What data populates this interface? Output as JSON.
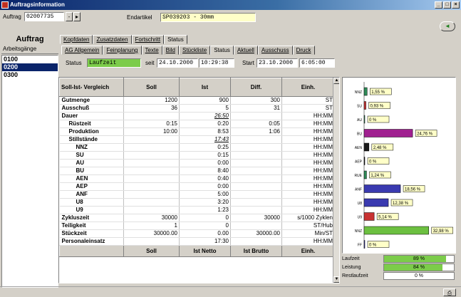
{
  "window": {
    "title": "Auftragsinformation"
  },
  "header": {
    "auftrag_label": "Auftrag",
    "auftrag_value": "02007735",
    "endartikel_label": "Endartikel",
    "endartikel_value": "SP039203 - 30mm",
    "section_title": "Auftrag"
  },
  "main_tabs": [
    "Kopfdaten",
    "Zusatzdaten",
    "Fortschritt",
    "Status"
  ],
  "sub_tabs": [
    "AG Allgemein",
    "Feinplanung",
    "Texte",
    "Bild",
    "Stückliste",
    "Status",
    "Aktuell",
    "Ausschuss",
    "Druck"
  ],
  "active_main_tab": 3,
  "active_sub_tab": 5,
  "status": {
    "label": "Status",
    "value": "Laufzeit",
    "seit_label": "seit",
    "seit_date": "24.10.2000",
    "seit_time": "10:29:38",
    "start_label": "Start",
    "start_date": "23.10.2000",
    "start_time": "6:05:00"
  },
  "left_panel": {
    "header": "Arbeitsgänge",
    "items": [
      "0100",
      "0200",
      "0300"
    ],
    "selected": 1
  },
  "grid": {
    "headers": [
      "Soll-Ist- Vergleich",
      "Soll",
      "Ist",
      "Diff.",
      "Einh."
    ],
    "footer": [
      "",
      "Soll",
      "Ist Netto",
      "Ist Brutto",
      "Einh."
    ],
    "rows": [
      {
        "name": "Gutmenge",
        "soll": "1200",
        "ist": "900",
        "diff": "300",
        "unit": "ST"
      },
      {
        "name": "Ausschuß",
        "soll": "36",
        "ist": "5",
        "diff": "31",
        "unit": "ST"
      },
      {
        "name": "Dauer",
        "soll": "",
        "ist": "26:50",
        "diff": "",
        "unit": "HH:MM"
      },
      {
        "name": "Rüstzeit",
        "soll": "0:15",
        "ist": "0:20",
        "diff": "0:05",
        "unit": "HH:MM"
      },
      {
        "name": "Produktion",
        "soll": "10:00",
        "ist": "8:53",
        "diff": "1:06",
        "unit": "HH:MM"
      },
      {
        "name": "Stillstände",
        "soll": "",
        "ist": "17:43",
        "diff": "",
        "unit": "HH:MM"
      },
      {
        "name": "NNZ",
        "soll": "",
        "ist": "0:25",
        "diff": "",
        "unit": "HH:MM"
      },
      {
        "name": "SU",
        "soll": "",
        "ist": "0:15",
        "diff": "",
        "unit": "HH:MM"
      },
      {
        "name": "AU",
        "soll": "",
        "ist": "0:00",
        "diff": "",
        "unit": "HH:MM"
      },
      {
        "name": "BU",
        "soll": "",
        "ist": "8:40",
        "diff": "",
        "unit": "HH:MM"
      },
      {
        "name": "AEN",
        "soll": "",
        "ist": "0:40",
        "diff": "",
        "unit": "HH:MM"
      },
      {
        "name": "AEP",
        "soll": "",
        "ist": "0:00",
        "diff": "",
        "unit": "HH:MM"
      },
      {
        "name": "ANF",
        "soll": "",
        "ist": "5:00",
        "diff": "",
        "unit": "HH:MM"
      },
      {
        "name": "U8",
        "soll": "",
        "ist": "3:20",
        "diff": "",
        "unit": "HH:MM"
      },
      {
        "name": "U9",
        "soll": "",
        "ist": "1:23",
        "diff": "",
        "unit": "HH:MM"
      },
      {
        "name": "Zykluszeit",
        "soll": "30000",
        "ist": "0",
        "diff": "30000",
        "unit": "s/1000 Zyklen"
      },
      {
        "name": "Teiligkeit",
        "soll": "1",
        "ist": "0",
        "diff": "",
        "unit": "ST/Hub"
      },
      {
        "name": "Stückzeit",
        "soll": "30000.00",
        "ist": "0.00",
        "diff": "30000.00",
        "unit": "Min/ST"
      },
      {
        "name": "Personaleinsatz",
        "soll": "",
        "ist": "17:30",
        "diff": "",
        "unit": "HH:MM"
      }
    ]
  },
  "chart_data": {
    "type": "bar",
    "orientation": "horizontal",
    "categories": [
      "NNZ",
      "SU",
      "AU",
      "BU",
      "AEN",
      "AEP",
      "RUE",
      "ANF",
      "U8",
      "U9",
      "NNZ",
      "FF"
    ],
    "values": [
      1.55,
      0.93,
      0,
      24.76,
      2.48,
      0,
      1.24,
      18.56,
      12.38,
      5.14,
      32.98,
      0
    ],
    "value_labels": [
      "1,55 %",
      "0,93 %",
      "0 %",
      "24,76 %",
      "2,48 %",
      "0 %",
      "1,24 %",
      "18,56 %",
      "12,38 %",
      "5,14 %",
      "32,98 %",
      "0 %"
    ],
    "colors": [
      "#2e8b57",
      "#c83232",
      "#2e8b57",
      "#a02090",
      "#1a1a1a",
      "#1a1a1a",
      "#2e8b57",
      "#3a3ab0",
      "#3a3ab0",
      "#c83232",
      "#6cc040",
      "#3a3ab0"
    ],
    "xlim": [
      0,
      40
    ]
  },
  "metrics": [
    {
      "label": "Laufzeit",
      "value": 89,
      "text": "89 %"
    },
    {
      "label": "Leistung",
      "value": 84,
      "text": "84 %"
    },
    {
      "label": "Restlaufzeit",
      "value": 0,
      "text": "0 %"
    }
  ]
}
